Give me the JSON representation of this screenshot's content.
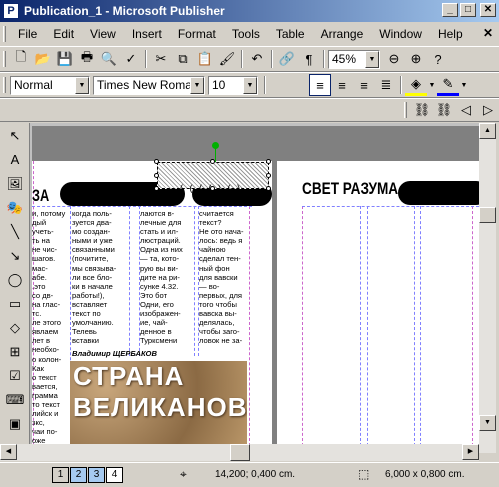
{
  "window": {
    "title": "Publication_1 - Microsoft Publisher",
    "app_icon": "P"
  },
  "menu": {
    "items": [
      "File",
      "Edit",
      "View",
      "Insert",
      "Format",
      "Tools",
      "Table",
      "Arrange",
      "Window",
      "Help"
    ]
  },
  "toolbar": {
    "zoom": "45%"
  },
  "format": {
    "style": "Normal",
    "font": "Times New Roman",
    "size": "10"
  },
  "document": {
    "heading_left": "ЗА",
    "heading_right": "СВЕТ РАЗУМА",
    "selected_text": "( ( ( ( ) ( )",
    "col1": "и, потому\nдый\nучеть-\nть на\nне чис-\nшагов.\nмас-\nабе.\n.это\nсо дв-\nна глас-\nтс.\nле этого\nявлаем\nлет в\nнеобхо-\nо колон-\nКак\nо текст\nвается,\nграмма\nто текст\nлийск и\nзкс,\nчаи по-\nоже\nмаху текс-\nв сле-",
    "col2": "когда поль-\nзуется два-\nмо создан-\nными и уже\nсвязанными\n(почитите,\nмы связыва-\nли все бло-\nки в начале\nработы!),\nвставляет\nтекст по\nумолчанию.\nТелевь\nвставки",
    "col3": "лаются в-\nлечные для\nстать и ил-\nлюстраций.\nОдна из них\n— та, кото-\nрую вы ви-\nдите на ри-\nсунке 4.32.\nЭто бот\nОдни, его\nизображен-\nие, чай-\nденное в\nТурксмени",
    "col4": "считается\nтекст?\nНе ото нача-\nлось: ведь я\nчайною\nсделал тен-\nный фон\nдля вавски\n— во-\nпервых, для\nтого чтобы\nвавска вы-\nделялась,\nчтобы заго-\nловок не за-",
    "author": "Владимир ЩЕРБАКОВ",
    "image_line1": "СТРАНА",
    "image_line2": "ВЕЛИКАНОВ"
  },
  "status": {
    "pages": [
      "1",
      "2",
      "3",
      "4"
    ],
    "position": "14,200; 0,400 cm.",
    "size": "6,000 x  0,800 cm."
  }
}
